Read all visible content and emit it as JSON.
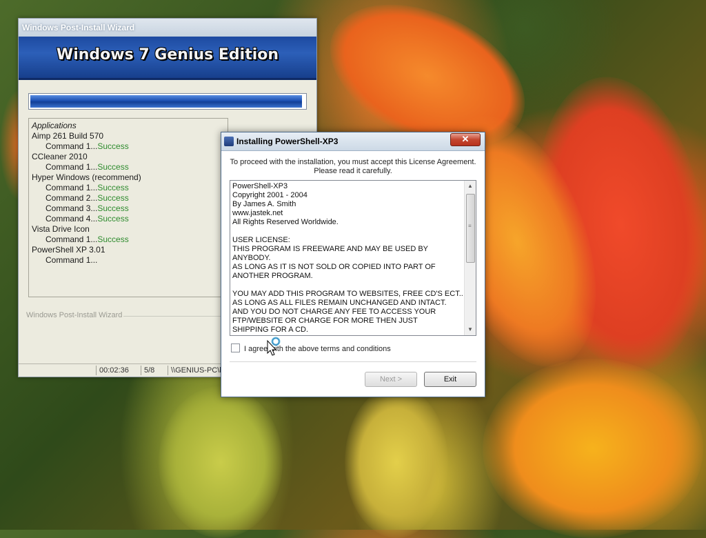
{
  "wizard": {
    "title": "Windows Post-Install Wizard",
    "banner": "Windows 7 Genius Edition",
    "progress": 0.99,
    "list": [
      {
        "text": "Applications",
        "type": "header"
      },
      {
        "text": "Aimp 261 Build 570",
        "type": "app"
      },
      {
        "text": "Command 1...",
        "status": "Success",
        "type": "cmd"
      },
      {
        "text": "CCleaner 2010",
        "type": "app"
      },
      {
        "text": "Command 1...",
        "status": "Success",
        "type": "cmd"
      },
      {
        "text": "Hyper Windows (recommend)",
        "type": "app"
      },
      {
        "text": "Command 1...",
        "status": "Success",
        "type": "cmd"
      },
      {
        "text": "Command 2...",
        "status": "Success",
        "type": "cmd"
      },
      {
        "text": "Command 3...",
        "status": "Success",
        "type": "cmd"
      },
      {
        "text": "Command 4...",
        "status": "Success",
        "type": "cmd"
      },
      {
        "text": "Vista Drive Icon",
        "type": "app"
      },
      {
        "text": "Command 1...",
        "status": "Success",
        "type": "cmd"
      },
      {
        "text": "PowerShell XP 3.01",
        "type": "app"
      },
      {
        "text": "Command 1...",
        "status": "",
        "type": "cmd"
      }
    ],
    "fieldset_label": "Windows Post-Install Wizard",
    "status": {
      "time": "00:02:36",
      "count": "5/8",
      "path": "\\\\GENIUS-PC\\hu"
    }
  },
  "dialog": {
    "title": "Installing PowerShell-XP3",
    "close_label": "✕",
    "intro_line1": "To proceed with the installation, you must accept this License Agreement.",
    "intro_line2": "Please read it carefully.",
    "license_text": "PowerShell-XP3\nCopyright 2001 - 2004\nBy James A. Smith\nwww.jastek.net\nAll Rights Reserved Worldwide.\n\nUSER LICENSE:\nTHIS PROGRAM IS FREEWARE AND MAY BE USED BY\nANYBODY.\nAS LONG AS IT IS NOT SOLD OR COPIED INTO PART OF\nANOTHER PROGRAM.\n\nYOU MAY ADD THIS PROGRAM TO WEBSITES, FREE CD'S ECT..\nAS LONG AS ALL FILES REMAIN UNCHANGED AND INTACT.\nAND YOU DO NOT CHARGE ANY FEE TO ACCESS YOUR\nFTP/WEBSITE OR CHARGE FOR MORE THEN JUST\nSHIPPING FOR A CD.",
    "agree_label": "I agree with the above terms and conditions",
    "agree_checked": false,
    "next_label": "Next >",
    "exit_label": "Exit"
  },
  "icons": {
    "scroll_up": "up-arrow-icon",
    "scroll_down": "down-arrow-icon",
    "app": "installer-icon",
    "cursor": "busy-cursor-icon"
  },
  "colors": {
    "success": "#2e8b2e",
    "banner": "#1d4aa0",
    "close": "#c4462f"
  }
}
